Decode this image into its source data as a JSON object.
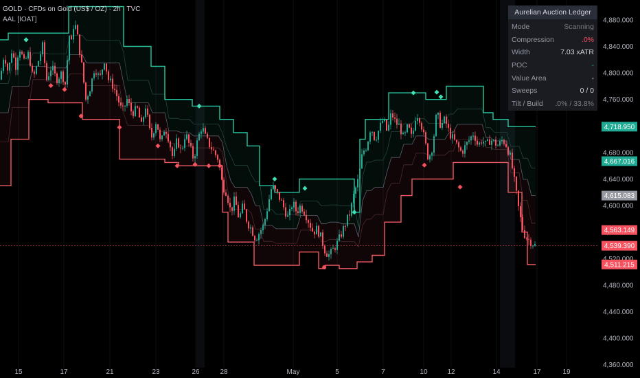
{
  "header": {
    "title": "GOLD · CFDs on Gold (US$ / OZ) · 2h · TVC",
    "indicator": "AAL [IOAT]"
  },
  "ledger": {
    "title": "Aurelian Auction Ledger",
    "rows": [
      {
        "label": "Mode",
        "value": "Scanning",
        "tone": "dim"
      },
      {
        "label": "Compression",
        "value": ".0%",
        "tone": "red"
      },
      {
        "label": "Width",
        "value": "7.03 xATR",
        "tone": "normal"
      },
      {
        "label": "POC",
        "value": "-",
        "tone": "teal"
      },
      {
        "label": "Value Area",
        "value": "-",
        "tone": "normal"
      },
      {
        "label": "Sweeps",
        "value": "0 / 0",
        "tone": "normal"
      },
      {
        "label": "Tilt / Build",
        "value": ".0% / 33.8%",
        "tone": "dim"
      }
    ]
  },
  "colors": {
    "bull": "#22ab94",
    "bear": "#f7525f",
    "upper_band": "#26c6a0",
    "lower_band": "#f05a64",
    "axis_text": "#b2b5be"
  },
  "chart_data": {
    "type": "candlestick",
    "instrument": "GOLD",
    "timeframe": "2h",
    "x_ticks": [
      "15",
      "17",
      "21",
      "23",
      "26",
      "28",
      "May",
      "5",
      "7",
      "10",
      "12",
      "14",
      "17",
      "19"
    ],
    "y_ticks": [
      4880,
      4840,
      4800,
      4760,
      4720,
      4680,
      4640,
      4600,
      4560,
      4520,
      4480,
      4440,
      4400,
      4360
    ],
    "ylim": [
      4340,
      4910
    ],
    "price_labels": [
      {
        "value": 4718.95,
        "text": "4,718.950",
        "color": "#22ab94"
      },
      {
        "value": 4667.016,
        "text": "4,667.016",
        "color": "#22ab94"
      },
      {
        "value": 4615.083,
        "text": "4,615.083",
        "color": "#9598a1"
      },
      {
        "value": 4563.149,
        "text": "4,563.149",
        "color": "#f7525f"
      },
      {
        "value": 4539.39,
        "text": "4,539.390",
        "color": "#f7525f"
      },
      {
        "value": 4511.215,
        "text": "4,511.215",
        "color": "#f7525f"
      }
    ],
    "last_price": 4539.39,
    "price_path": [
      [
        0,
        4790
      ],
      [
        6,
        4830
      ],
      [
        12,
        4800
      ],
      [
        18,
        4840
      ],
      [
        22,
        4805
      ],
      [
        28,
        4840
      ],
      [
        35,
        4815
      ],
      [
        42,
        4830
      ],
      [
        48,
        4790
      ],
      [
        55,
        4815
      ],
      [
        62,
        4840
      ],
      [
        68,
        4790
      ],
      [
        75,
        4810
      ],
      [
        82,
        4790
      ],
      [
        90,
        4800
      ],
      [
        96,
        4780
      ],
      [
        100,
        4860
      ],
      [
        104,
        4845
      ],
      [
        108,
        4880
      ],
      [
        112,
        4860
      ],
      [
        118,
        4820
      ],
      [
        125,
        4760
      ],
      [
        132,
        4780
      ],
      [
        138,
        4810
      ],
      [
        145,
        4790
      ],
      [
        152,
        4820
      ],
      [
        158,
        4790
      ],
      [
        165,
        4780
      ],
      [
        172,
        4760
      ],
      [
        178,
        4740
      ],
      [
        185,
        4760
      ],
      [
        192,
        4740
      ],
      [
        200,
        4745
      ],
      [
        206,
        4720
      ],
      [
        212,
        4750
      ],
      [
        220,
        4700
      ],
      [
        228,
        4730
      ],
      [
        234,
        4690
      ],
      [
        240,
        4720
      ],
      [
        246,
        4700
      ],
      [
        252,
        4670
      ],
      [
        258,
        4700
      ],
      [
        264,
        4680
      ],
      [
        270,
        4710
      ],
      [
        276,
        4690
      ],
      [
        282,
        4670
      ],
      [
        288,
        4700
      ],
      [
        294,
        4720
      ],
      [
        300,
        4700
      ],
      [
        306,
        4690
      ],
      [
        312,
        4680
      ],
      [
        318,
        4670
      ],
      [
        324,
        4630
      ],
      [
        330,
        4620
      ],
      [
        336,
        4590
      ],
      [
        342,
        4610
      ],
      [
        348,
        4580
      ],
      [
        354,
        4600
      ],
      [
        360,
        4575
      ],
      [
        366,
        4565
      ],
      [
        372,
        4550
      ],
      [
        378,
        4560
      ],
      [
        384,
        4570
      ],
      [
        390,
        4600
      ],
      [
        396,
        4630
      ],
      [
        402,
        4620
      ],
      [
        408,
        4610
      ],
      [
        414,
        4595
      ],
      [
        420,
        4580
      ],
      [
        426,
        4605
      ],
      [
        432,
        4590
      ],
      [
        438,
        4600
      ],
      [
        444,
        4590
      ],
      [
        450,
        4575
      ],
      [
        456,
        4560
      ],
      [
        462,
        4565
      ],
      [
        468,
        4550
      ],
      [
        474,
        4530
      ],
      [
        480,
        4525
      ],
      [
        486,
        4535
      ],
      [
        492,
        4545
      ],
      [
        498,
        4560
      ],
      [
        504,
        4575
      ],
      [
        510,
        4590
      ],
      [
        516,
        4620
      ],
      [
        522,
        4640
      ],
      [
        528,
        4680
      ],
      [
        534,
        4690
      ],
      [
        540,
        4720
      ],
      [
        546,
        4700
      ],
      [
        552,
        4715
      ],
      [
        558,
        4730
      ],
      [
        564,
        4710
      ],
      [
        570,
        4740
      ],
      [
        576,
        4725
      ],
      [
        582,
        4720
      ],
      [
        588,
        4700
      ],
      [
        594,
        4720
      ],
      [
        600,
        4700
      ],
      [
        606,
        4740
      ],
      [
        612,
        4730
      ],
      [
        618,
        4700
      ],
      [
        624,
        4670
      ],
      [
        630,
        4690
      ],
      [
        636,
        4740
      ],
      [
        642,
        4720
      ],
      [
        648,
        4730
      ],
      [
        654,
        4710
      ],
      [
        660,
        4700
      ],
      [
        666,
        4690
      ],
      [
        672,
        4680
      ],
      [
        678,
        4690
      ],
      [
        684,
        4700
      ],
      [
        690,
        4710
      ],
      [
        696,
        4690
      ],
      [
        702,
        4700
      ],
      [
        708,
        4690
      ],
      [
        714,
        4700
      ],
      [
        720,
        4695
      ],
      [
        726,
        4690
      ],
      [
        732,
        4700
      ],
      [
        738,
        4690
      ],
      [
        744,
        4670
      ],
      [
        750,
        4630
      ],
      [
        756,
        4590
      ],
      [
        762,
        4560
      ],
      [
        768,
        4550
      ],
      [
        774,
        4545
      ],
      [
        780,
        4539
      ]
    ],
    "upper_band": [
      [
        0,
        4850
      ],
      [
        12,
        4850
      ],
      [
        12,
        4860
      ],
      [
        28,
        4860
      ],
      [
        28,
        4860
      ],
      [
        56,
        4860
      ],
      [
        56,
        4860
      ],
      [
        100,
        4860
      ],
      [
        100,
        4900
      ],
      [
        180,
        4900
      ],
      [
        180,
        4840
      ],
      [
        220,
        4840
      ],
      [
        220,
        4810
      ],
      [
        240,
        4810
      ],
      [
        240,
        4760
      ],
      [
        280,
        4760
      ],
      [
        280,
        4750
      ],
      [
        320,
        4750
      ],
      [
        320,
        4730
      ],
      [
        340,
        4730
      ],
      [
        340,
        4710
      ],
      [
        360,
        4710
      ],
      [
        360,
        4690
      ],
      [
        378,
        4690
      ],
      [
        378,
        4630
      ],
      [
        400,
        4630
      ],
      [
        400,
        4620
      ],
      [
        436,
        4620
      ],
      [
        436,
        4640
      ],
      [
        516,
        4640
      ],
      [
        516,
        4590
      ],
      [
        524,
        4590
      ],
      [
        524,
        4700
      ],
      [
        532,
        4700
      ],
      [
        532,
        4730
      ],
      [
        566,
        4730
      ],
      [
        566,
        4770
      ],
      [
        620,
        4770
      ],
      [
        620,
        4760
      ],
      [
        650,
        4760
      ],
      [
        650,
        4780
      ],
      [
        704,
        4780
      ],
      [
        704,
        4740
      ],
      [
        718,
        4740
      ],
      [
        718,
        4730
      ],
      [
        740,
        4730
      ],
      [
        740,
        4719
      ],
      [
        780,
        4719
      ]
    ],
    "lower_band": [
      [
        0,
        4630
      ],
      [
        16,
        4630
      ],
      [
        16,
        4700
      ],
      [
        42,
        4700
      ],
      [
        42,
        4760
      ],
      [
        70,
        4760
      ],
      [
        70,
        4755
      ],
      [
        120,
        4755
      ],
      [
        120,
        4730
      ],
      [
        174,
        4730
      ],
      [
        174,
        4670
      ],
      [
        240,
        4670
      ],
      [
        240,
        4665
      ],
      [
        260,
        4665
      ],
      [
        260,
        4660
      ],
      [
        324,
        4660
      ],
      [
        324,
        4590
      ],
      [
        332,
        4590
      ],
      [
        332,
        4545
      ],
      [
        370,
        4545
      ],
      [
        370,
        4510
      ],
      [
        436,
        4510
      ],
      [
        436,
        4530
      ],
      [
        464,
        4530
      ],
      [
        464,
        4505
      ],
      [
        474,
        4505
      ],
      [
        474,
        4510
      ],
      [
        494,
        4510
      ],
      [
        494,
        4505
      ],
      [
        520,
        4505
      ],
      [
        520,
        4515
      ],
      [
        542,
        4515
      ],
      [
        542,
        4525
      ],
      [
        560,
        4525
      ],
      [
        560,
        4575
      ],
      [
        584,
        4575
      ],
      [
        584,
        4615
      ],
      [
        600,
        4615
      ],
      [
        600,
        4640
      ],
      [
        660,
        4640
      ],
      [
        660,
        4665
      ],
      [
        740,
        4665
      ],
      [
        740,
        4620
      ],
      [
        760,
        4620
      ],
      [
        760,
        4560
      ],
      [
        768,
        4560
      ],
      [
        768,
        4511
      ],
      [
        780,
        4511
      ]
    ],
    "bull_markers": [
      [
        38,
        4850
      ],
      [
        290,
        4750
      ],
      [
        400,
        4640
      ],
      [
        444,
        4626
      ],
      [
        516,
        4590
      ],
      [
        602,
        4770
      ],
      [
        636,
        4771
      ],
      [
        642,
        4764
      ]
    ],
    "bear_markers": [
      [
        74,
        4781
      ],
      [
        94,
        4775
      ],
      [
        118,
        4735
      ],
      [
        174,
        4718
      ],
      [
        230,
        4690
      ],
      [
        258,
        4660
      ],
      [
        284,
        4662
      ],
      [
        304,
        4660
      ],
      [
        320,
        4660
      ],
      [
        472,
        4507
      ],
      [
        618,
        4661
      ],
      [
        670,
        4628
      ]
    ]
  }
}
